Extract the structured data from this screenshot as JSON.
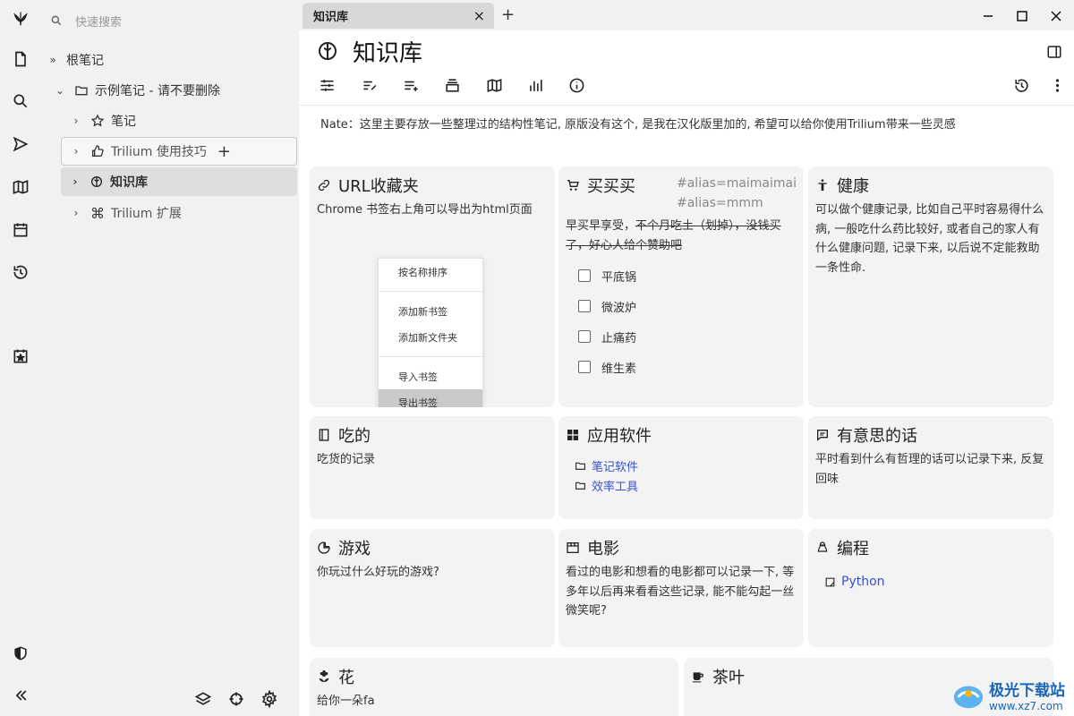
{
  "app": {
    "brand_color": "#222222",
    "accent": "#3650d3"
  },
  "launcher": {
    "items": [
      "logo-icon",
      "new-note-icon",
      "search-icon",
      "send-icon",
      "map-icon",
      "calendar-icon",
      "history-icon",
      "calendar-star-icon",
      "shield-icon",
      "collapse-icon"
    ]
  },
  "tree": {
    "search_placeholder": "快速搜索",
    "nodes": [
      {
        "label": "根笔记",
        "arrow": "»"
      },
      {
        "label": "示例笔记 - 请不要删除",
        "arrow": "⌄"
      },
      {
        "label": "笔记",
        "arrow": "›"
      },
      {
        "label": "Trilium 使用技巧",
        "arrow": "›",
        "plus": "+"
      },
      {
        "label": "知识库",
        "arrow": "›"
      },
      {
        "label": "Trilium 扩展",
        "arrow": "›"
      }
    ]
  },
  "tabs": {
    "active_label": "知识库",
    "close": "×",
    "new": "+"
  },
  "page": {
    "title": "知识库",
    "note": "Nate：这里主要存放一些整理过的结构性笔记, 原版没有这个, 是我在汉化版里加的, 希望可以给你使用Trilium带来一些灵感"
  },
  "cards": {
    "url": {
      "title": "URL收藏夹",
      "text": "Chrome 书签右上角可以导出为html页面",
      "menu": [
        "按名称排序",
        "添加新书签",
        "添加新文件夹",
        "导入书签",
        "导出书签"
      ]
    },
    "buy": {
      "title": "买买买",
      "tag": "#alias=maimaimai #alias=mmm",
      "text_a": "早买早享受，",
      "text_b": "不个月吃土（划掉），没钱买了，好心人给个赞助吧",
      "items": [
        "平底锅",
        "微波炉",
        "止痛药",
        "维生素"
      ]
    },
    "health": {
      "title": "健康",
      "text": "可以做个健康记录, 比如自己平时容易得什么病, 一般吃什么药比较好, 或者自己的家人有什么健康问题, 记录下来, 以后说不定能救助一条性命."
    },
    "food": {
      "title": "吃的",
      "text": "吃货的记录"
    },
    "apps": {
      "title": "应用软件",
      "links": [
        "笔记软件",
        "效率工具"
      ]
    },
    "quote": {
      "title": "有意思的话",
      "text": "平时看到什么有哲理的话可以记录下来, 反复回味"
    },
    "game": {
      "title": "游戏",
      "text": "你玩过什么好玩的游戏?"
    },
    "movie": {
      "title": "电影",
      "text": "看过的电影和想看的电影都可以记录一下, 等多年以后再来看看这些记录, 能不能勾起一丝微笑呢?"
    },
    "code": {
      "title": "编程",
      "links": [
        "Python"
      ]
    },
    "flower": {
      "title": "花",
      "text": "给你一朵fa"
    },
    "tea": {
      "title": "茶叶"
    }
  },
  "watermark": {
    "brand": "极光下载站",
    "url": "www.xz7.com"
  }
}
